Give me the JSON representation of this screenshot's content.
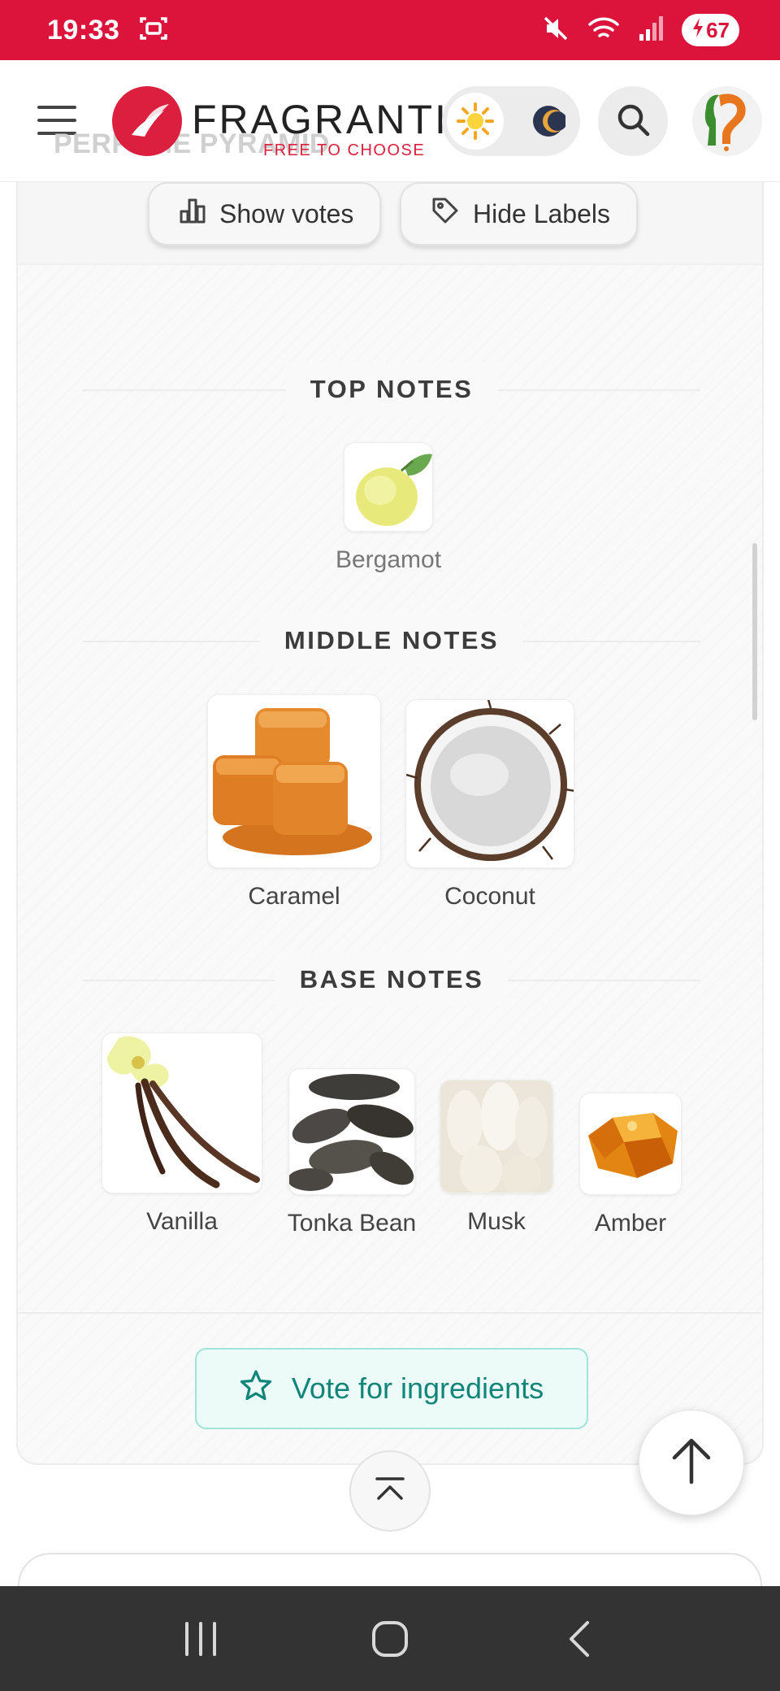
{
  "status_bar": {
    "time": "19:33",
    "battery": "67",
    "icons": [
      "screenshot-icon",
      "mute-icon",
      "wifi-icon",
      "signal-icon",
      "battery-charging-icon"
    ]
  },
  "header": {
    "logo_text": "FRAGRANTICA",
    "logo_visible_text": "FRAGRANTIC",
    "logo_tagline": "FREE TO CHOOSE",
    "ghost_breadcrumb": "PERFUME PYRAMID",
    "icons": [
      "menu-icon",
      "sun-icon",
      "moon-icon",
      "search-icon",
      "avatar-icon"
    ]
  },
  "toolbar": {
    "show_votes_label": "Show votes",
    "hide_labels_label": "Hide Labels"
  },
  "pyramid": {
    "top": {
      "heading": "TOP NOTES",
      "notes": [
        {
          "name": "Bergamot"
        }
      ]
    },
    "middle": {
      "heading": "MIDDLE NOTES",
      "notes": [
        {
          "name": "Caramel"
        },
        {
          "name": "Coconut"
        }
      ]
    },
    "base": {
      "heading": "BASE NOTES",
      "notes": [
        {
          "name": "Vanilla"
        },
        {
          "name": "Tonka Bean"
        },
        {
          "name": "Musk"
        },
        {
          "name": "Amber"
        }
      ]
    }
  },
  "vote_button": {
    "label": "Vote for ingredients"
  },
  "colors": {
    "brand": "#dc143c",
    "vote_text": "#11857a",
    "vote_bg": "#ecfbf8",
    "vote_border": "#9ee4d8"
  }
}
